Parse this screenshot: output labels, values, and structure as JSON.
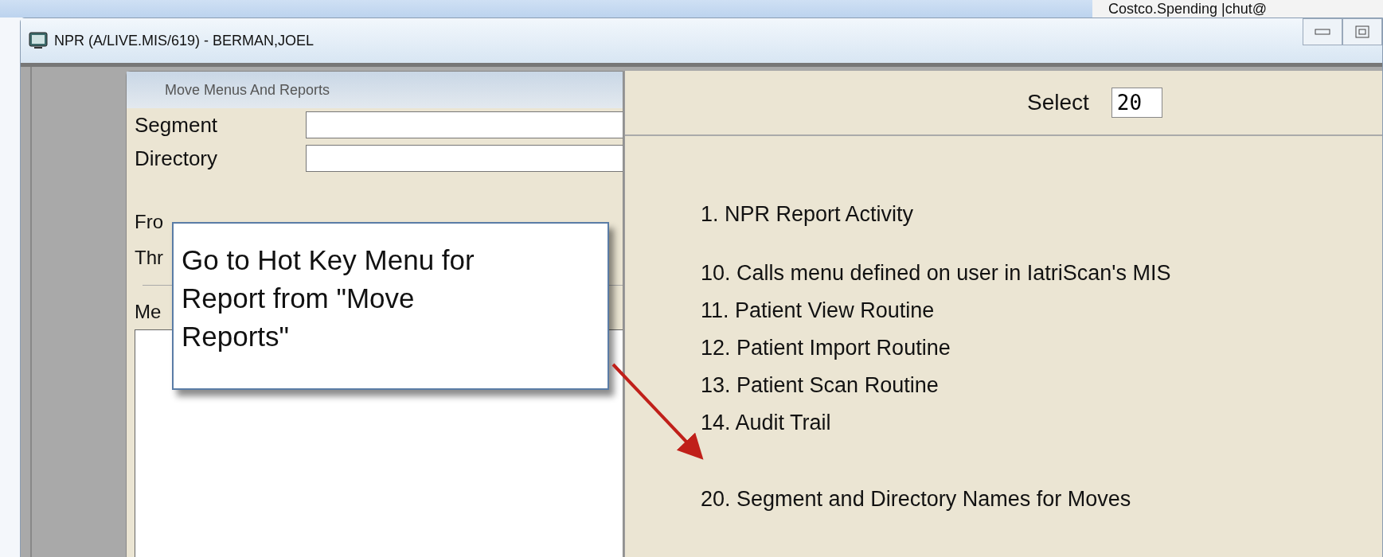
{
  "background": {
    "text": "Costco.Spending |chut@"
  },
  "window": {
    "title": "NPR (A/LIVE.MIS/619) - BERMAN,JOEL"
  },
  "dialog": {
    "title": "Move Menus And Reports",
    "fields": [
      {
        "label": "Segment"
      },
      {
        "label": "Directory"
      }
    ],
    "partial_labels": [
      "Fro",
      "Thr"
    ],
    "list_label": "Me"
  },
  "select": {
    "label": "Select",
    "value": "20"
  },
  "menu_groups": [
    [
      "1. NPR Report Activity"
    ],
    [
      "10. Calls menu defined on user in IatriScan's MIS",
      "11. Patient View Routine",
      "12. Patient Import Routine",
      "13. Patient Scan Routine",
      "14. Audit Trail"
    ],
    [
      "20. Segment and Directory Names for Moves"
    ]
  ],
  "callout": {
    "text": "Go to Hot Key Menu for Report from \"Move Reports\""
  }
}
